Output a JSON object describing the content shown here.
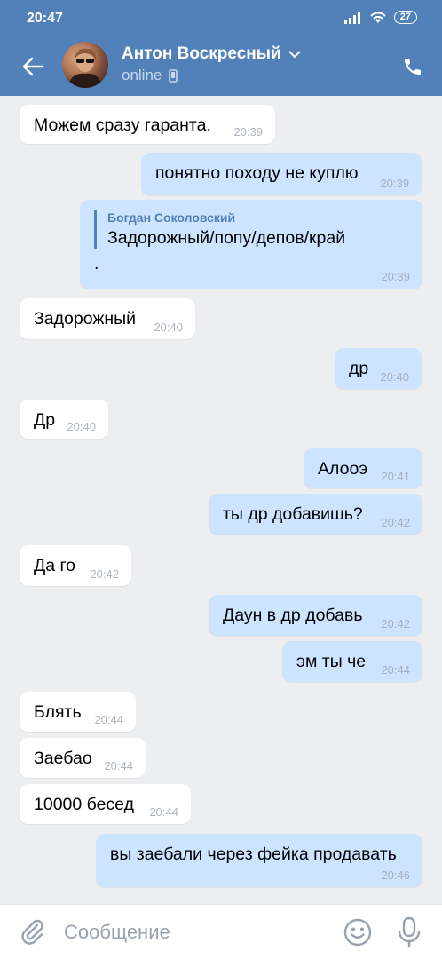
{
  "status_bar": {
    "time": "20:47",
    "battery": "27"
  },
  "header": {
    "contact_name": "Антон Воскресный",
    "status": "online",
    "icons": [
      "back-arrow-icon",
      "chevron-down-icon",
      "mobile-phone-icon",
      "phone-icon"
    ]
  },
  "messages": [
    {
      "dir": "in",
      "text": "Можем сразу гаранта.",
      "time": "20:39"
    },
    {
      "dir": "out",
      "text": "понятно походу не куплю",
      "time": "20:39"
    },
    {
      "dir": "out",
      "reply_author": "Богдан Соколовский",
      "text": "Задорожный/попу/депов/край",
      "extra": ".",
      "time": "20:39"
    },
    {
      "dir": "in",
      "text": "Задорожный",
      "time": "20:40"
    },
    {
      "dir": "out",
      "text": "др",
      "time": "20:40"
    },
    {
      "dir": "in",
      "text": "Др",
      "time": "20:40"
    },
    {
      "dir": "out",
      "text": "Алооэ",
      "time": "20:41"
    },
    {
      "dir": "out",
      "text": "ты др добавишь?",
      "time": "20:42"
    },
    {
      "dir": "in",
      "text": "Да го",
      "time": "20:42"
    },
    {
      "dir": "out",
      "text": "Даун в др добавь",
      "time": "20:42"
    },
    {
      "dir": "out",
      "text": "эм ты че",
      "time": "20:44"
    },
    {
      "dir": "in",
      "text": "Блять",
      "time": "20:44"
    },
    {
      "dir": "in",
      "text": "Заебао",
      "time": "20:44"
    },
    {
      "dir": "in",
      "text": "10000 бесед",
      "time": "20:44"
    },
    {
      "dir": "out",
      "text": "вы заебали через фейка продавать",
      "time": "20:46"
    }
  ],
  "input": {
    "placeholder": "Сообщение"
  },
  "colors": {
    "header": "#5181b8",
    "outgoing": "#cce4ff",
    "incoming": "#ffffff",
    "background": "#edeef0"
  }
}
